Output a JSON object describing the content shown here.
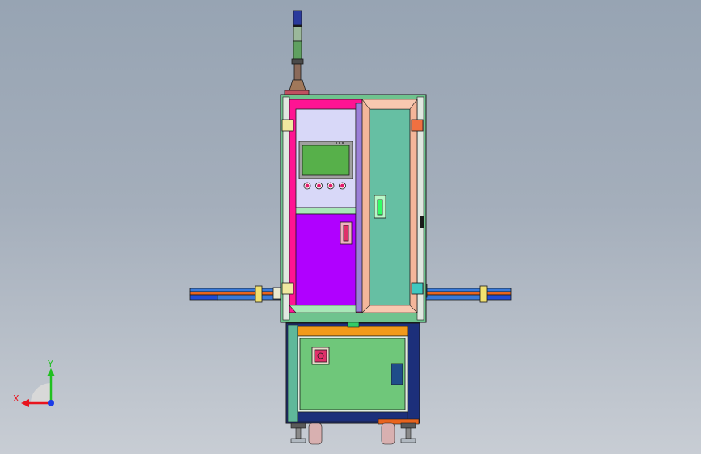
{
  "viewport": {
    "background_top": "#97a4b3",
    "background_bottom": "#c8cdd4"
  },
  "machine": {
    "colors": {
      "outline": "#1a1a1a",
      "frame_green": "#6fc38e",
      "frame_teal": "#5fb89a",
      "magenta_panel": "#ff00ff",
      "magenta_border": "#ff1493",
      "purple_door": "#b000ff",
      "lavender_panel": "#d8d8f8",
      "right_door": "#66bfa3",
      "peach_border": "#f4b69a",
      "blue_strip": "#3a20ff",
      "indigo_strip": "#9b7fd8",
      "hmi_screen": "#57b04a",
      "hmi_bezel": "#8c8c8c",
      "orange_bar": "#f29a1a",
      "lower_cabinet": "#6fc77a",
      "lower_sides": "#1c2f7a",
      "handle_green": "#33ff66",
      "handle_red": "#e0306a",
      "handle_navy": "#1f4d8a",
      "rail_blue": "#1f4bd6",
      "rail_orange": "#e8641e",
      "tower_blue": "#2a3a9c",
      "tower_green": "#5fa060"
    },
    "buttons": [
      "#e01a6a",
      "#e01a6a",
      "#e01a6a",
      "#e01a6a"
    ]
  },
  "triad": {
    "x_label": "X",
    "y_label": "Y",
    "x_color": "#e8141e",
    "y_color": "#20c020",
    "z_color": "#1a3be8"
  }
}
